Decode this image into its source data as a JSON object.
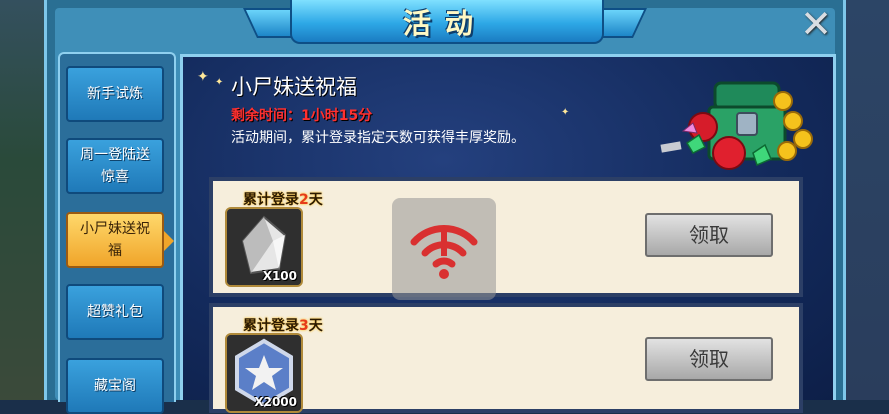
{
  "window": {
    "title": "活动",
    "close_label": "✕"
  },
  "sidebar": {
    "items": [
      {
        "label": "新手试炼",
        "active": false
      },
      {
        "label": "周一登陆送惊喜",
        "active": false
      },
      {
        "label": "小尸妹送祝福",
        "active": true
      },
      {
        "label": "超赞礼包",
        "active": false
      },
      {
        "label": "藏宝阁",
        "active": false
      }
    ]
  },
  "activity": {
    "title": "小尸妹送祝福",
    "remaining_label": "剩余时间：",
    "remaining_value": "1小时15分",
    "description": "活动期间，累计登录指定天数可获得丰厚奖励。"
  },
  "rewards": [
    {
      "label_prefix": "累计登录",
      "days": "2",
      "label_suffix": "天",
      "item_icon": "silver-crystal-icon",
      "quantity": "X100",
      "button_label": "领取"
    },
    {
      "label_prefix": "累计登录",
      "days": "3",
      "label_suffix": "天",
      "item_icon": "star-badge-icon",
      "quantity": "X2000",
      "button_label": "领取"
    }
  ],
  "overlay": {
    "icon": "no-network-icon"
  },
  "colors": {
    "accent_gold": "#f0a52a",
    "alert_red": "#ff3030",
    "banner_blue": "#2ea8e6"
  }
}
